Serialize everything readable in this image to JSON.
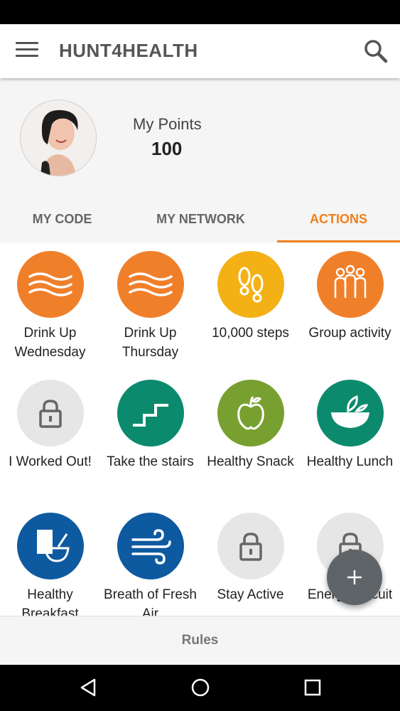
{
  "app": {
    "title": "HUNT4HEALTH"
  },
  "profile": {
    "points_label": "My Points",
    "points_value": "100"
  },
  "tabs": [
    {
      "label": "MY CODE"
    },
    {
      "label": "MY NETWORK"
    },
    {
      "label": "ACTIONS",
      "active": true
    }
  ],
  "actions": [
    {
      "label": "Drink Up Wednesday",
      "icon": "water-waves-icon",
      "color": "#f07f2a"
    },
    {
      "label": "Drink Up Thursday",
      "icon": "water-waves-icon",
      "color": "#f07f2a"
    },
    {
      "label": "10,000 steps",
      "icon": "footprints-icon",
      "color": "#f3b116"
    },
    {
      "label": "Group activity",
      "icon": "group-people-icon",
      "color": "#f07f2a"
    },
    {
      "label": "I Worked Out!",
      "icon": "lock-icon",
      "color": "#e6e6e6"
    },
    {
      "label": "Take the stairs",
      "icon": "stairs-icon",
      "color": "#0c8a6e"
    },
    {
      "label": "Healthy Snack",
      "icon": "apple-icon",
      "color": "#78a030"
    },
    {
      "label": "Healthy Lunch",
      "icon": "salad-bowl-icon",
      "color": "#0c8a6e"
    },
    {
      "label": "Healthy Breakfast",
      "icon": "cereal-bowl-icon",
      "color": "#0e5aa0"
    },
    {
      "label": "Breath of Fresh Air",
      "icon": "wind-icon",
      "color": "#0e5aa0"
    },
    {
      "label": "Stay Active",
      "icon": "lock-icon",
      "color": "#e6e6e6"
    },
    {
      "label": "Energy Circuit",
      "icon": "lock-icon",
      "color": "#e6e6e6"
    }
  ],
  "bottom": {
    "rules_label": "Rules"
  },
  "fab": {
    "icon": "plus-icon"
  },
  "colors": {
    "accent": "#ef7f1a"
  }
}
